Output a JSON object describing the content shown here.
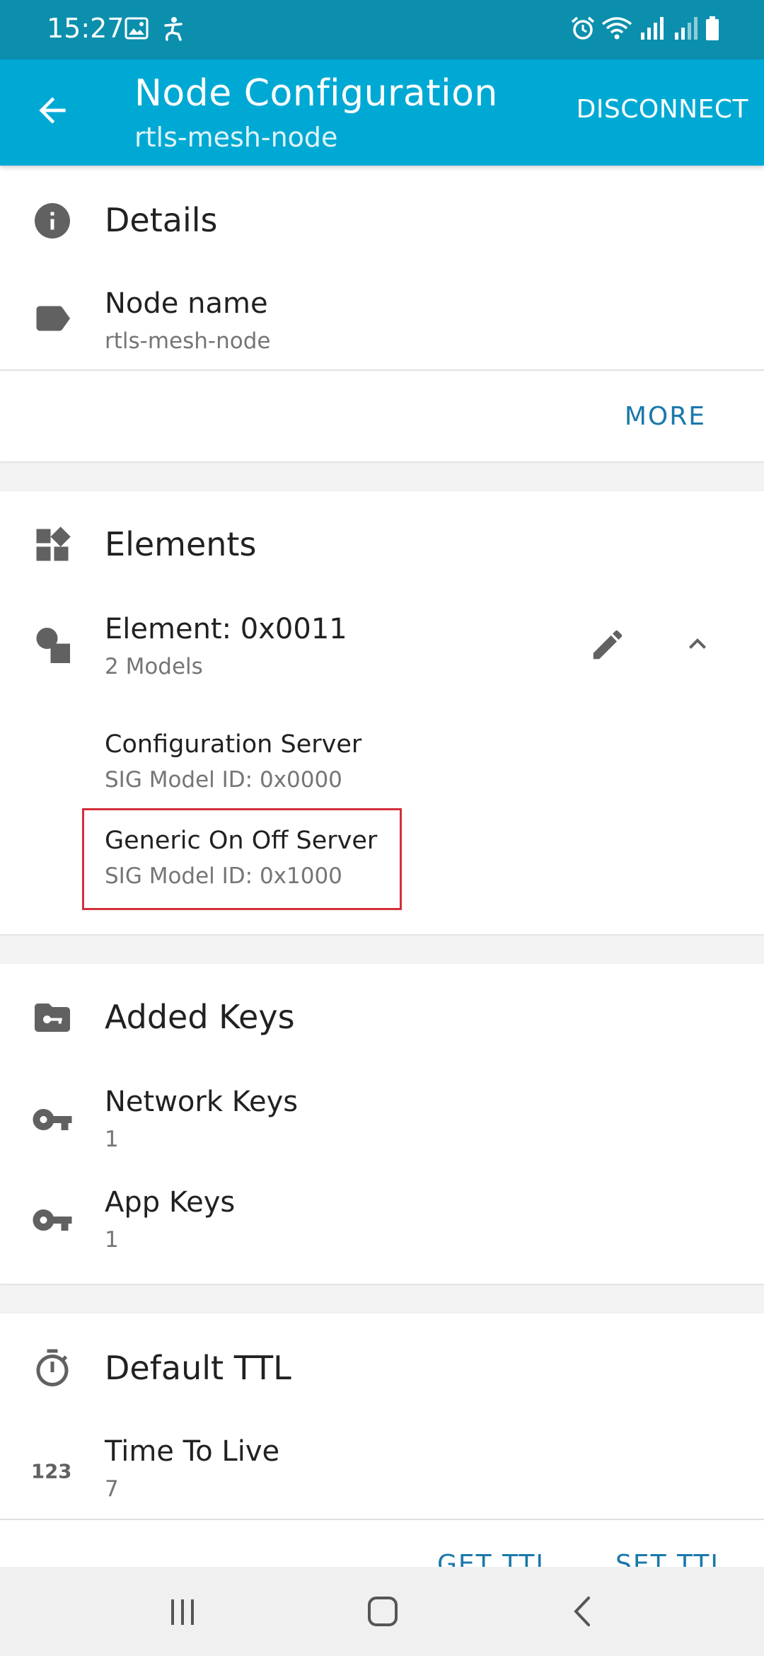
{
  "status_bar": {
    "time": "15:27",
    "left_icons": [
      "image-icon",
      "accessibility-icon"
    ],
    "right_icons": [
      "alarm-icon",
      "wifi-icon",
      "signal-icon",
      "signal-icon",
      "battery-icon"
    ]
  },
  "app_bar": {
    "title": "Node Configuration",
    "subtitle": "rtls-mesh-node",
    "action": "DISCONNECT",
    "back_icon": "arrow-back-icon"
  },
  "details": {
    "header": "Details",
    "header_icon": "info-icon",
    "node_name_label": "Node name",
    "node_name_value": "rtls-mesh-node",
    "node_name_icon": "label-icon",
    "more_button": "MORE"
  },
  "elements": {
    "header": "Elements",
    "header_icon": "widgets-icon",
    "element": {
      "title": "Element: 0x0011",
      "subtitle": "2 Models",
      "icon": "category-icon",
      "models": [
        {
          "name": "Configuration Server",
          "id": "SIG Model ID: 0x0000"
        },
        {
          "name": "Generic On Off Server",
          "id": "SIG Model ID: 0x1000"
        }
      ]
    }
  },
  "keys": {
    "header": "Added Keys",
    "header_icon": "folder-key-icon",
    "items": [
      {
        "label": "Network Keys",
        "value": "1",
        "icon": "key-icon"
      },
      {
        "label": "App Keys",
        "value": "1",
        "icon": "key-icon"
      }
    ]
  },
  "ttl": {
    "header": "Default TTL",
    "header_icon": "timer-icon",
    "label": "Time To Live",
    "value": "7",
    "value_icon": "numbers-icon",
    "get_button": "GET TTL",
    "set_button": "SET TTL"
  },
  "colors": {
    "status_bar": "#0b8fad",
    "app_bar": "#00a9d4",
    "accent_text": "#1a78ab",
    "highlight": "#d32f3a"
  }
}
